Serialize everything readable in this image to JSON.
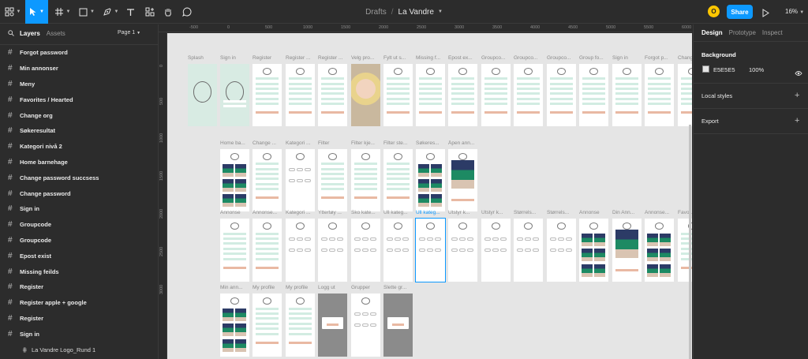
{
  "toolbar": {
    "tools": [
      "main-menu",
      "move",
      "frame",
      "shape",
      "pen",
      "text",
      "resources",
      "hand",
      "comment"
    ],
    "breadcrumb_team": "Drafts",
    "breadcrumb_sep": "/",
    "file_name": "La Vandre",
    "avatar_initial": "O",
    "share_label": "Share",
    "zoom_level": "16%"
  },
  "left_panel": {
    "tab_layers": "Layers",
    "tab_assets": "Assets",
    "page_selector": "Page 1",
    "layers": [
      {
        "label": "Forgot password"
      },
      {
        "label": "Min annonser"
      },
      {
        "label": "Meny"
      },
      {
        "label": "Favorites / Hearted"
      },
      {
        "label": "Change org"
      },
      {
        "label": "Søkeresultat"
      },
      {
        "label": "Kategori nivå 2"
      },
      {
        "label": "Home barnehage"
      },
      {
        "label": "Change password succsess"
      },
      {
        "label": "Change password"
      },
      {
        "label": "Sign in"
      },
      {
        "label": "Groupcode"
      },
      {
        "label": "Groupcode"
      },
      {
        "label": "Epost exist"
      },
      {
        "label": "Missing feilds"
      },
      {
        "label": "Register"
      },
      {
        "label": "Register apple + google"
      },
      {
        "label": "Register"
      },
      {
        "label": "Sign in"
      }
    ],
    "sub_layer": "La Vandre Logo_Rund 1"
  },
  "rulers": {
    "horizontal": [
      "-500",
      "0",
      "500",
      "1000",
      "1500",
      "2000",
      "2500",
      "3000",
      "3500",
      "4000",
      "4500",
      "5000",
      "5500",
      "6000"
    ],
    "vertical": [
      "0",
      "500",
      "1000",
      "1500",
      "2000",
      "2500",
      "3000"
    ]
  },
  "canvas": {
    "row1": [
      "Splash",
      "Sign in",
      "Register",
      "Register ...",
      "Register ...",
      "Velg pro...",
      "Fylt ut s...",
      "Missing f...",
      "Epost ex...",
      "Groupco...",
      "Groupco...",
      "Groupco...",
      "Group fo...",
      "Sign in",
      "Forgot p...",
      "Chang..."
    ],
    "row2": [
      "Home ba...",
      "Change ...",
      "Kategori ...",
      "Filter",
      "Filter kje...",
      "Filter ste...",
      "Søkeres...",
      "Åpen ann..."
    ],
    "row3": [
      "Annonse",
      "Annonse...",
      "Kategori ...",
      "Yttertøy ...",
      "Sko kate...",
      "Ull kateg...",
      "Ull kateg...",
      "Utstyr k...",
      "Utstyr k...",
      "Størrels...",
      "Størrels...",
      "Annonse",
      "Din Ann...",
      "Annonse...",
      "Favor..."
    ],
    "row4": [
      "Min ann...",
      "My profile",
      "My profile",
      "Logg ut",
      "Grupper",
      "Slette gr..."
    ],
    "selected_frame": "Ull kateg..."
  },
  "right_panel": {
    "tab_design": "Design",
    "tab_prototype": "Prototype",
    "tab_inspect": "Inspect",
    "background_title": "Background",
    "background_hex": "E5E5E5",
    "background_opacity": "100%",
    "local_styles": "Local styles",
    "export": "Export"
  },
  "colors": {
    "accent": "#0d99ff",
    "canvas": "#e5e5e5",
    "mint": "#d8ebe3",
    "peach": "#e9b9a3"
  }
}
